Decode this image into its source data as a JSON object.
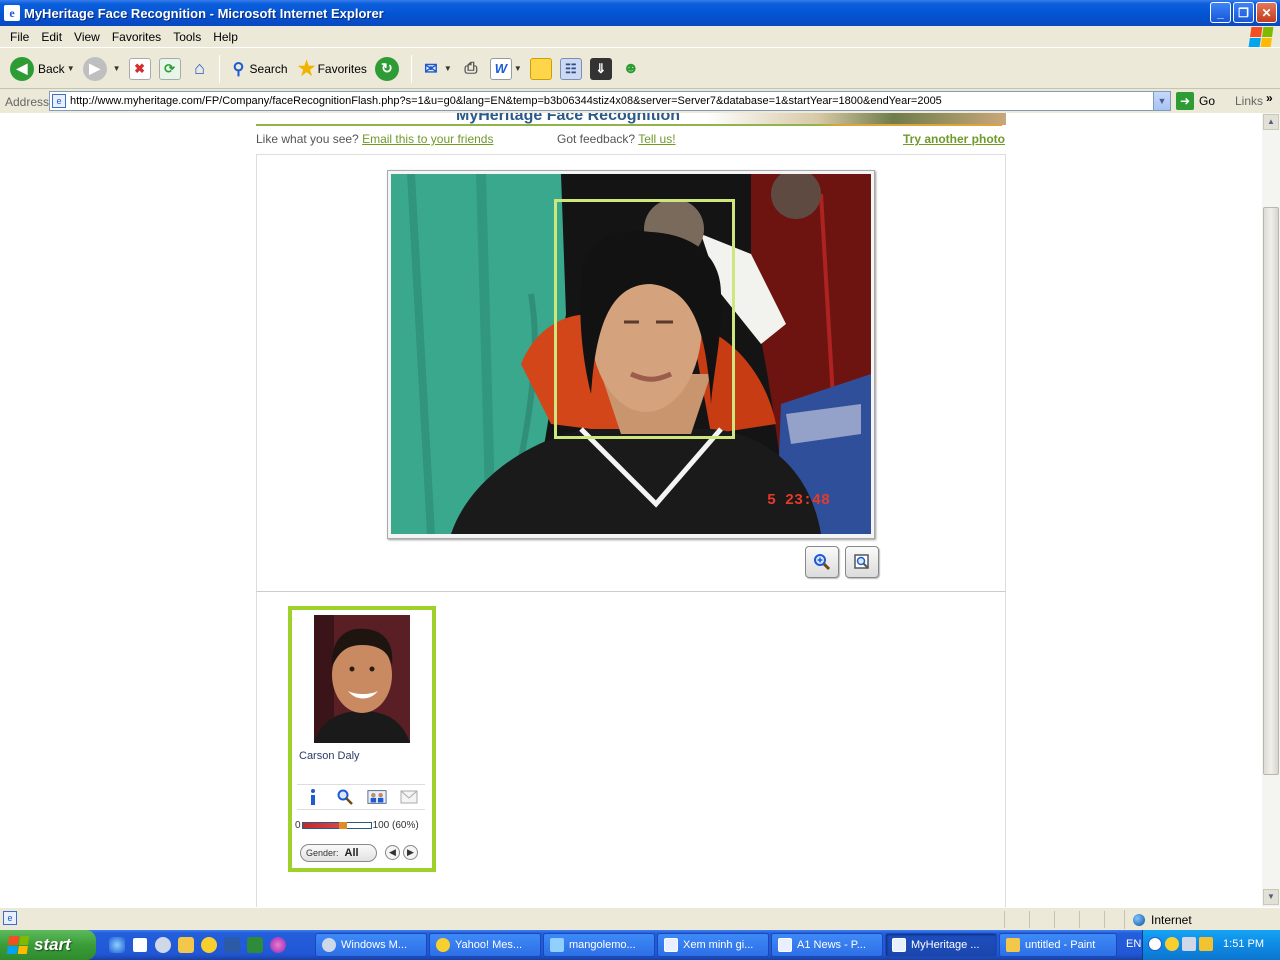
{
  "window": {
    "title": "MyHeritage Face Recognition - Microsoft Internet Explorer",
    "controls": {
      "minimize": "_",
      "maximize": "❐",
      "close": "✕"
    }
  },
  "menu": [
    "File",
    "Edit",
    "View",
    "Favorites",
    "Tools",
    "Help"
  ],
  "toolbar": {
    "back": "Back",
    "search": "Search",
    "favorites": "Favorites"
  },
  "address": {
    "label": "Address",
    "url": "http://www.myheritage.com/FP/Company/faceRecognitionFlash.php?s=1&u=g0&lang=EN&temp=b3b06344stiz4x08&server=Server7&database=1&startYear=1800&endYear=2005",
    "go": "Go",
    "links": "Links"
  },
  "page": {
    "banner_title": "MyHeritage Face Recognition",
    "like_prompt": "Like what you see?",
    "email_link": "Email this to your friends",
    "feedback_prompt": "Got feedback?",
    "tell_link": "Tell us!",
    "try_another": "Try another photo",
    "photo_timestamp": "5 23:48",
    "match": {
      "name": "Carson Daly",
      "score_min": "0",
      "score_max": "100 (60%)",
      "score_fraction": 0.6,
      "gender_label": "Gender:",
      "gender_value": "All"
    }
  },
  "status": {
    "zone": "Internet"
  },
  "taskbar": {
    "start": "start",
    "tasks": [
      "Windows M...",
      "Yahoo! Mes...",
      "mangolemo...",
      "Xem minh gi...",
      "A1 News - P...",
      "MyHeritage ...",
      "untitled - Paint"
    ],
    "lang": "EN",
    "clock": "1:51 PM"
  },
  "colors": {
    "accent_green": "#9ed12a",
    "link_green": "#6f9a28",
    "face_box": "#cde77c",
    "xp_blue": "#0453d1"
  }
}
